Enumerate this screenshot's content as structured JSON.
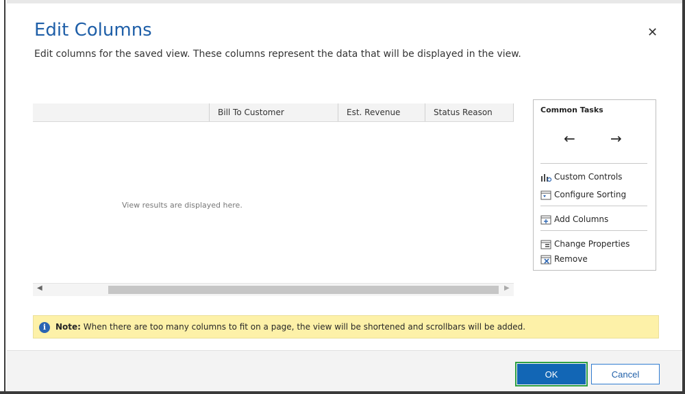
{
  "dialog": {
    "title": "Edit Columns",
    "subtitle": "Edit columns for the saved view. These columns represent the data that will be displayed in the view.",
    "close_glyph": "✕"
  },
  "grid": {
    "columns": [
      "Bill To Customer",
      "Est. Revenue",
      "Status Reason"
    ],
    "empty_message": "View results are displayed here."
  },
  "common_tasks": {
    "title": "Common Tasks",
    "arrow_left": "←",
    "arrow_right": "→",
    "items": [
      {
        "label": "Custom Controls",
        "icon": "custom-controls-icon"
      },
      {
        "label": "Configure Sorting",
        "icon": "configure-sorting-icon"
      },
      {
        "label": "Add Columns",
        "icon": "add-columns-icon"
      },
      {
        "label": "Change Properties",
        "icon": "change-properties-icon"
      },
      {
        "label": "Remove",
        "icon": "remove-icon"
      }
    ]
  },
  "note": {
    "label": "Note:",
    "text": " When there are too many columns to fit on a page, the view will be shortened and scrollbars will be added."
  },
  "footer": {
    "ok_label": "OK",
    "cancel_label": "Cancel"
  },
  "colors": {
    "accent": "#1266b5",
    "title": "#1f5fa8",
    "note_bg": "#fdf1a8",
    "focus_outline": "#2ea043"
  }
}
